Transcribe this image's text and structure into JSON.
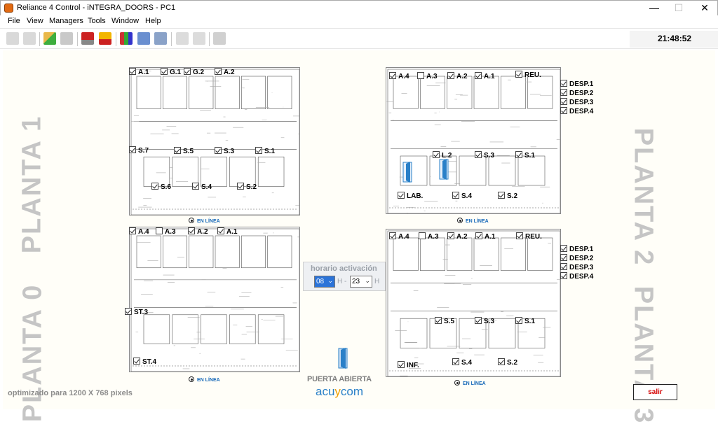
{
  "window": {
    "title": "Reliance 4 Control - iNTEGRA_DOORS - PC1",
    "min": "—",
    "max": "☐",
    "close": "✕"
  },
  "menu": [
    "File",
    "View",
    "Managers",
    "Tools",
    "Window",
    "Help"
  ],
  "clock": "21:48:52",
  "labels": {
    "p1": "PLANTA 1",
    "p0": "PLANTA 0",
    "p2": "PLANTA 2",
    "p3": "PLANTA 3"
  },
  "status": "EN LÍNEA",
  "horario": {
    "label": "horario activación",
    "start": "08",
    "start_unit": "H",
    "sep": "-",
    "end": "23",
    "end_unit": "H"
  },
  "logo": {
    "line1": "PUERTA ABIERTA",
    "line2a": "acu",
    "line2b": "y",
    "line2c": "com"
  },
  "note": "optimizado para 1200 X 768 pixels",
  "salir": "salir",
  "plans": {
    "planta1": [
      {
        "t": "A.1",
        "on": true
      },
      {
        "t": "G.1",
        "on": true
      },
      {
        "t": "G.2",
        "on": true
      },
      {
        "t": "A.2",
        "on": true
      },
      {
        "t": "S.7",
        "on": true
      },
      {
        "t": "S.5",
        "on": true
      },
      {
        "t": "S.3",
        "on": true
      },
      {
        "t": "S.1",
        "on": true
      },
      {
        "t": "S.6",
        "on": true
      },
      {
        "t": "S.4",
        "on": true
      },
      {
        "t": "S.2",
        "on": true
      }
    ],
    "planta0": [
      {
        "t": "A.4",
        "on": true
      },
      {
        "t": "A.3",
        "on": false
      },
      {
        "t": "A.2",
        "on": true
      },
      {
        "t": "A.1",
        "on": true
      },
      {
        "t": "ST.3",
        "on": true
      },
      {
        "t": "ST.4",
        "on": true
      }
    ],
    "planta2": [
      {
        "t": "A.4",
        "on": true
      },
      {
        "t": "A.3",
        "on": false
      },
      {
        "t": "A.2",
        "on": true
      },
      {
        "t": "A.1",
        "on": true
      },
      {
        "t": "REU.",
        "on": true
      },
      {
        "t": "DESP.1",
        "on": true
      },
      {
        "t": "DESP.2",
        "on": true
      },
      {
        "t": "DESP.3",
        "on": true
      },
      {
        "t": "DESP.4",
        "on": true
      },
      {
        "t": "L.2",
        "on": true
      },
      {
        "t": "S.3",
        "on": true
      },
      {
        "t": "S.1",
        "on": true
      },
      {
        "t": "LAB.",
        "on": true
      },
      {
        "t": "S.4",
        "on": true
      },
      {
        "t": "S.2",
        "on": true
      }
    ],
    "planta3": [
      {
        "t": "A.4",
        "on": true
      },
      {
        "t": "A.3",
        "on": false
      },
      {
        "t": "A.2",
        "on": true
      },
      {
        "t": "A.1",
        "on": true
      },
      {
        "t": "REU.",
        "on": true
      },
      {
        "t": "DESP.1",
        "on": true
      },
      {
        "t": "DESP.2",
        "on": true
      },
      {
        "t": "DESP.3",
        "on": true
      },
      {
        "t": "DESP.4",
        "on": true
      },
      {
        "t": "S.5",
        "on": true
      },
      {
        "t": "S.3",
        "on": true
      },
      {
        "t": "S.1",
        "on": true
      },
      {
        "t": "INF.",
        "on": true
      },
      {
        "t": "S.4",
        "on": true
      },
      {
        "t": "S.2",
        "on": true
      }
    ]
  }
}
